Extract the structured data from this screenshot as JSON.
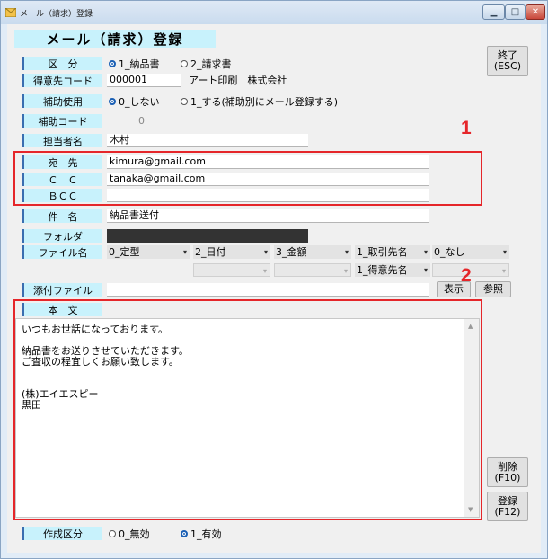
{
  "window": {
    "title": "メール（請求）登録",
    "minimize_icon": "minimize-icon",
    "maximize_icon": "maximize-icon",
    "close_icon": "close-icon"
  },
  "form_title": "メール（請求）登録",
  "kubun": {
    "label": "区　分",
    "options": [
      "1_納品書",
      "2_請求書"
    ],
    "selected": 0
  },
  "customer": {
    "label": "得意先コード",
    "code": "000001",
    "name": "アート印刷　株式会社"
  },
  "aux_use": {
    "label": "補助使用",
    "options": [
      "0_しない",
      "1_する(補助別にメール登録する)"
    ],
    "selected": 0
  },
  "aux_code": {
    "label": "補助コード",
    "value": "0"
  },
  "person": {
    "label": "担当者名",
    "value": "木村"
  },
  "recipients": {
    "to_label": "宛　先",
    "to": "kimura@gmail.com",
    "cc_label": "Ｃ　Ｃ",
    "cc": "tanaka@gmail.com",
    "bcc_label": "ＢＣＣ",
    "bcc": ""
  },
  "subject": {
    "label": "件　名",
    "value": "納品書送付"
  },
  "folder": {
    "label": "フォルダ",
    "value": ""
  },
  "filename": {
    "label": "ファイル名",
    "row1": [
      "0_定型",
      "2_日付",
      "3_金額",
      "1_取引先名",
      "0_なし"
    ],
    "row2_label": "1_得意先名"
  },
  "attachment": {
    "label": "添付ファイル",
    "value": "",
    "show_button": "表示",
    "browse_button": "参照"
  },
  "body": {
    "label": "本　文",
    "text": "いつもお世話になっております。\n\n納品書をお送りさせていただきます。\nご査収の程宜しくお願い致します。\n\n\n(株)エイエスピー\n黒田"
  },
  "creation": {
    "label": "作成区分",
    "options": [
      "0_無効",
      "1_有効"
    ],
    "selected": 1
  },
  "buttons": {
    "exit_line1": "終了",
    "exit_line2": "(ESC)",
    "delete_line1": "削除",
    "delete_line2": "(F10)",
    "register_line1": "登録",
    "register_line2": "(F12)"
  },
  "annotations": {
    "marker1": "1",
    "marker2": "2"
  },
  "colors": {
    "label_bg": "#c8f2fc",
    "annotation_red": "#e5262a",
    "selected_radio": "#1a5fb4",
    "folder_field": "#333333"
  }
}
